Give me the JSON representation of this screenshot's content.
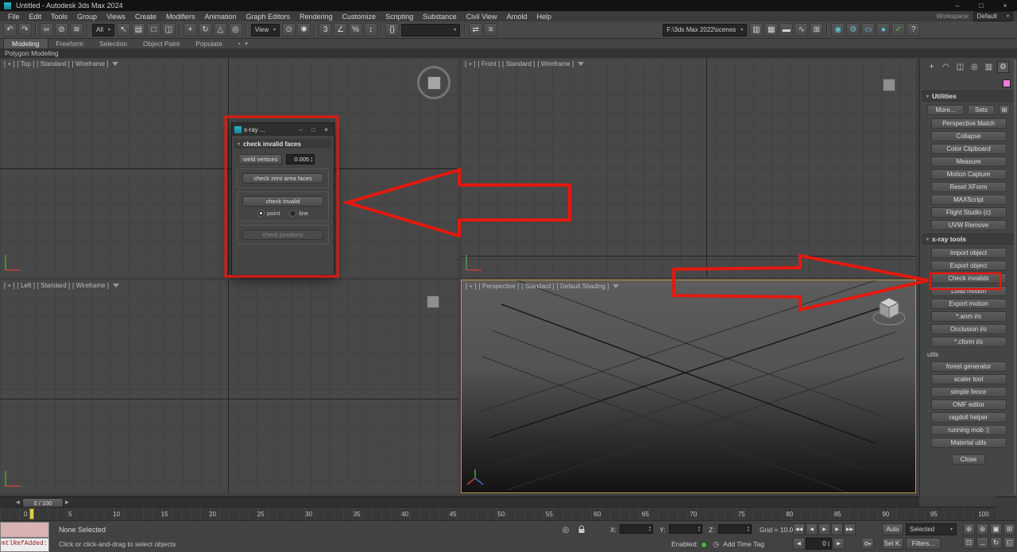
{
  "annotation": {
    "red": "#e3190f"
  },
  "glyphs": {
    "caret_down": "▾",
    "spinner_up": "▴",
    "spinner_down": "▾"
  },
  "window": {
    "title": "Untitled - Autodesk 3ds Max 2024",
    "minimize": "–",
    "maximize": "□",
    "close": "×"
  },
  "menubar": {
    "items": [
      "File",
      "Edit",
      "Tools",
      "Group",
      "Views",
      "Create",
      "Modifiers",
      "Animation",
      "Graph Editors",
      "Rendering",
      "Customize",
      "Scripting",
      "Substance",
      "Civil View",
      "Arnold",
      "Help"
    ],
    "workspace_label": "Workspace:",
    "workspace_value": "Default"
  },
  "toolbar": {
    "history_icons": [
      {
        "name": "undo-icon",
        "glyph": "↶"
      },
      {
        "name": "redo-icon",
        "glyph": "↷"
      }
    ],
    "link_icons": [
      {
        "name": "select-and-link-icon",
        "glyph": "∞"
      },
      {
        "name": "unlink-selection-icon",
        "glyph": "⊘"
      },
      {
        "name": "bind-to-space-warp-icon",
        "glyph": "≋"
      }
    ],
    "filter_value": "All",
    "select_icons": [
      {
        "name": "select-object-icon",
        "glyph": "↖"
      },
      {
        "name": "select-by-name-icon",
        "glyph": "▤"
      },
      {
        "name": "rectangular-selection-region-icon",
        "glyph": "□"
      },
      {
        "name": "window-crossing-icon",
        "glyph": "◫"
      }
    ],
    "transform_icons": [
      {
        "name": "select-and-move-icon",
        "glyph": "+"
      },
      {
        "name": "select-and-rotate-icon",
        "glyph": "↻"
      },
      {
        "name": "select-and-scale-icon",
        "glyph": "△"
      },
      {
        "name": "select-and-place-icon",
        "glyph": "◎"
      }
    ],
    "view_value": "View",
    "pivot_icons": [
      {
        "name": "use-pivot-point-icon",
        "glyph": "⊙"
      },
      {
        "name": "select-and-manipulate-icon",
        "glyph": "✱"
      }
    ],
    "snap_icons": [
      {
        "name": "snaps-toggle-icon",
        "glyph": "3"
      },
      {
        "name": "angle-snap-icon",
        "glyph": "∠"
      },
      {
        "name": "percent-snap-icon",
        "glyph": "%"
      },
      {
        "name": "spinner-snap-icon",
        "glyph": "↕"
      }
    ],
    "named_sets_glyph": "{}",
    "sets_value": "",
    "mirror_icons": [
      {
        "name": "mirror-icon",
        "glyph": "⇄"
      },
      {
        "name": "align-icon",
        "glyph": "≡"
      }
    ],
    "project_path": "F:\\3ds Max 2022\\scenes",
    "explorer_icons": [
      {
        "name": "scene-explorer-icon",
        "glyph": "▥"
      },
      {
        "name": "layer-explorer-icon",
        "glyph": "▦"
      },
      {
        "name": "toggle-ribbon-icon",
        "glyph": "▬"
      },
      {
        "name": "curve-editor-icon",
        "glyph": "∿"
      },
      {
        "name": "schematic-view-icon",
        "glyph": "⊞"
      }
    ],
    "render_icons": [
      {
        "name": "material-editor-icon",
        "glyph": "◉",
        "cls": "teal"
      },
      {
        "name": "render-setup-icon",
        "glyph": "⚙",
        "cls": "teal"
      },
      {
        "name": "rendered-frame-window-icon",
        "glyph": "▭",
        "cls": "teal"
      },
      {
        "name": "render-production-icon",
        "glyph": "●",
        "cls": "teal"
      },
      {
        "name": "render-cloud-icon",
        "glyph": "✓",
        "cls": "green"
      },
      {
        "name": "help-icon",
        "glyph": "?",
        "cls": ""
      }
    ]
  },
  "ribbon": {
    "tabs": [
      "Modeling",
      "Freeform",
      "Selection",
      "Object Paint",
      "Populate"
    ],
    "strip_label": "Polygon Modeling"
  },
  "viewports": {
    "top": {
      "parts": [
        "[ + ]",
        "[ Top ]",
        "[ Standard ]",
        "[ Wireframe ]"
      ]
    },
    "front": {
      "parts": [
        "[ + ]",
        "[ Front ]",
        "[ Standard ]",
        "[ Wireframe ]"
      ]
    },
    "left": {
      "parts": [
        "[ + ]",
        "[ Left ]",
        "[ Standard ]",
        "[ Wireframe ]"
      ]
    },
    "perspective": {
      "parts": [
        "[ + ]",
        "[ Perspective ]",
        "[ Standard ]",
        "[ Default Shading ]"
      ]
    }
  },
  "dialog": {
    "title": "x-ray ...",
    "rollout": "check invalid faces",
    "weld_button": "weld vertices",
    "weld_value": "0.005",
    "zero_area_button": "check zero area faces",
    "invalid_button": "check invalid",
    "radio_point": "point",
    "radio_line": "line",
    "junctions_button": "check junctions"
  },
  "panel": {
    "tabs": [
      {
        "name": "create-tab",
        "glyph": "+"
      },
      {
        "name": "modify-tab",
        "glyph": "◠"
      },
      {
        "name": "hierarchy-tab",
        "glyph": "◫"
      },
      {
        "name": "motion-tab",
        "glyph": "◎"
      },
      {
        "name": "display-tab",
        "glyph": "▥"
      },
      {
        "name": "utilities-tab",
        "glyph": "⚙",
        "cls": "active"
      }
    ],
    "utilities_header": "Utilities",
    "more_button": "More...",
    "sets_button": "Sets",
    "utility_buttons": [
      "Perspective Match",
      "Collapse",
      "Color Clipboard",
      "Measure",
      "Motion Capture",
      "Reset XForm",
      "MAXScript",
      "Flight Studio (c)",
      "UVW Remove"
    ],
    "xray_header": "x-ray tools",
    "xray_buttons": [
      "Import object",
      "Export object",
      "Check invalids",
      "Load motion",
      "Export motion",
      "*.anm i/o",
      "Occlusion i/o",
      "*.cform i/o"
    ],
    "utils_label": "utils",
    "utils_buttons": [
      "forest generator",
      "scaler tool",
      "simple fence",
      "OMF editor",
      "ragdoll helper",
      "running mob :)",
      "Material utils"
    ],
    "close_button": "Close"
  },
  "timeline": {
    "slider": "0 / 100",
    "ticks": [
      "0",
      "5",
      "10",
      "15",
      "20",
      "25",
      "30",
      "35",
      "40",
      "45",
      "50",
      "55",
      "60",
      "65",
      "70",
      "75",
      "80",
      "85",
      "90",
      "95",
      "100"
    ]
  },
  "status": {
    "listener_text": "mtlRefAdded: X",
    "selection": "None Selected",
    "prompt": "Click or click-and-drag to select objects",
    "x_label": "X:",
    "y_label": "Y:",
    "z_label": "Z:",
    "x_value": "",
    "y_value": "",
    "z_value": "",
    "grid": "Grid = 10.0",
    "enabled_label": "Enabled:",
    "add_time_tag": "Add Time Tag",
    "time_value": "0",
    "auto_button": "Auto",
    "selected_dropdown": "Selected",
    "setkey_button": "Set K.",
    "filters_button": "Filters...",
    "playback": [
      {
        "name": "go-to-start-button",
        "glyph": "◀◀"
      },
      {
        "name": "previous-frame-button",
        "glyph": "◀"
      },
      {
        "name": "play-button",
        "glyph": "▶"
      },
      {
        "name": "next-frame-button",
        "glyph": "▶"
      },
      {
        "name": "go-to-end-button",
        "glyph": "▶▶"
      }
    ],
    "nav_icons": [
      {
        "name": "zoom-icon",
        "glyph": "⊕"
      },
      {
        "name": "zoom-all-icon",
        "glyph": "⊛"
      },
      {
        "name": "zoom-extents-icon",
        "glyph": "▣"
      },
      {
        "name": "zoom-extents-all-icon",
        "glyph": "⊞"
      },
      {
        "name": "zoom-region-icon",
        "glyph": "⊡"
      },
      {
        "name": "pan-icon",
        "glyph": "↔"
      },
      {
        "name": "orbit-icon",
        "glyph": "↻"
      },
      {
        "name": "maximize-viewport-icon",
        "glyph": "◱"
      }
    ]
  }
}
